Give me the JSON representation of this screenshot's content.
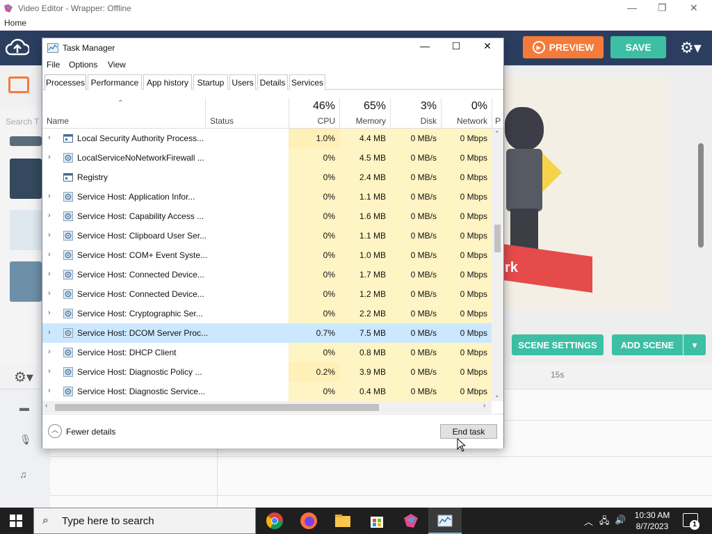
{
  "editor": {
    "title": "Video Editor - Wrapper: Offline",
    "menu_home": "Home",
    "preview_label": "PREVIEW",
    "save_label": "SAVE",
    "search_hint": "Search T",
    "banner_text": "rk",
    "scene_settings_label": "SCENE SETTINGS",
    "add_scene_label": "ADD SCENE",
    "timeline_marker": "15s"
  },
  "taskmanager": {
    "title": "Task Manager",
    "menu": [
      "File",
      "Options",
      "View"
    ],
    "tabs": [
      "Processes",
      "Performance",
      "App history",
      "Startup",
      "Users",
      "Details",
      "Services"
    ],
    "active_tab": "Processes",
    "columns": {
      "name": "Name",
      "status": "Status",
      "cpu_pct": "46%",
      "cpu": "CPU",
      "mem_pct": "65%",
      "mem": "Memory",
      "disk_pct": "3%",
      "disk": "Disk",
      "net_pct": "0%",
      "net": "Network",
      "extra": "P"
    },
    "rows": [
      {
        "name": "Local Security Authority Process...",
        "cpu": "1.0%",
        "mem": "4.4 MB",
        "disk": "0 MB/s",
        "net": "0 Mbps",
        "icon": "window",
        "expand": true
      },
      {
        "name": "LocalServiceNoNetworkFirewall ...",
        "cpu": "0%",
        "mem": "4.5 MB",
        "disk": "0 MB/s",
        "net": "0 Mbps",
        "icon": "gear",
        "expand": true
      },
      {
        "name": "Registry",
        "cpu": "0%",
        "mem": "2.4 MB",
        "disk": "0 MB/s",
        "net": "0 Mbps",
        "icon": "window",
        "expand": false
      },
      {
        "name": "Service Host: Application Infor...",
        "cpu": "0%",
        "mem": "1.1 MB",
        "disk": "0 MB/s",
        "net": "0 Mbps",
        "icon": "gear",
        "expand": true
      },
      {
        "name": "Service Host: Capability Access ...",
        "cpu": "0%",
        "mem": "1.6 MB",
        "disk": "0 MB/s",
        "net": "0 Mbps",
        "icon": "gear",
        "expand": true
      },
      {
        "name": "Service Host: Clipboard User Ser...",
        "cpu": "0%",
        "mem": "1.1 MB",
        "disk": "0 MB/s",
        "net": "0 Mbps",
        "icon": "gear",
        "expand": true
      },
      {
        "name": "Service Host: COM+ Event Syste...",
        "cpu": "0%",
        "mem": "1.0 MB",
        "disk": "0 MB/s",
        "net": "0 Mbps",
        "icon": "gear",
        "expand": true
      },
      {
        "name": "Service Host: Connected Device...",
        "cpu": "0%",
        "mem": "1.7 MB",
        "disk": "0 MB/s",
        "net": "0 Mbps",
        "icon": "gear",
        "expand": true
      },
      {
        "name": "Service Host: Connected Device...",
        "cpu": "0%",
        "mem": "1.2 MB",
        "disk": "0 MB/s",
        "net": "0 Mbps",
        "icon": "gear",
        "expand": true
      },
      {
        "name": "Service Host: Cryptographic Ser...",
        "cpu": "0%",
        "mem": "2.2 MB",
        "disk": "0 MB/s",
        "net": "0 Mbps",
        "icon": "gear",
        "expand": true
      },
      {
        "name": "Service Host: DCOM Server Proc...",
        "cpu": "0.7%",
        "mem": "7.5 MB",
        "disk": "0 MB/s",
        "net": "0 Mbps",
        "icon": "gear",
        "expand": true,
        "selected": true
      },
      {
        "name": "Service Host: DHCP Client",
        "cpu": "0%",
        "mem": "0.8 MB",
        "disk": "0 MB/s",
        "net": "0 Mbps",
        "icon": "gear",
        "expand": true
      },
      {
        "name": "Service Host: Diagnostic Policy ...",
        "cpu": "0.2%",
        "mem": "3.9 MB",
        "disk": "0 MB/s",
        "net": "0 Mbps",
        "icon": "gear",
        "expand": true
      },
      {
        "name": "Service Host: Diagnostic Service...",
        "cpu": "0%",
        "mem": "0.4 MB",
        "disk": "0 MB/s",
        "net": "0 Mbps",
        "icon": "gear",
        "expand": true
      }
    ],
    "fewer_details": "Fewer details",
    "end_task": "End task"
  },
  "taskbar": {
    "search_placeholder": "Type here to search",
    "time": "10:30 AM",
    "date": "8/7/2023",
    "notifications": "1"
  },
  "colors": {
    "editor_toolbar": "#2c3e60",
    "preview": "#f47b3a",
    "save": "#3cbfa5",
    "selected_row": "#cce8ff",
    "heat": "#fff4c4"
  }
}
